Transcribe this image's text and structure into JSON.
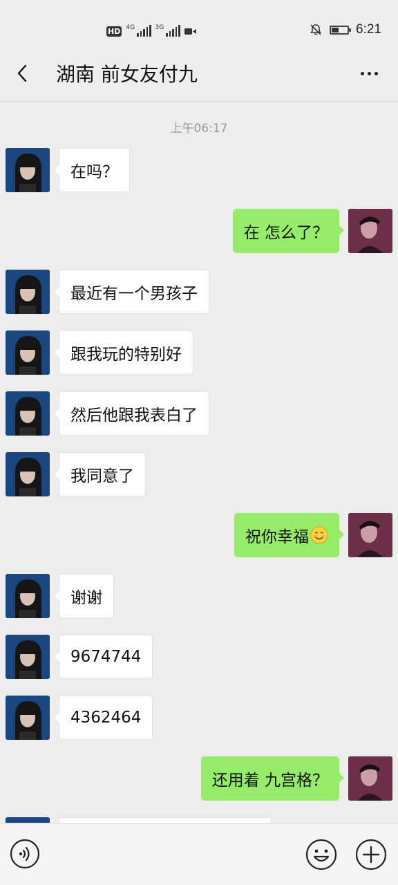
{
  "status_bar": {
    "hd": "HD",
    "net1": "4G",
    "net2": "3G",
    "time": "6:21"
  },
  "header": {
    "title": "湖南 前女友付九"
  },
  "timestamp": "上午06:17",
  "messages": [
    {
      "side": "left",
      "text": "在吗？"
    },
    {
      "side": "right",
      "text": "在 怎么了？"
    },
    {
      "side": "left",
      "text": "最近有一个男孩子"
    },
    {
      "side": "left",
      "text": "跟我玩的特别好"
    },
    {
      "side": "left",
      "text": "然后他跟我表白了"
    },
    {
      "side": "left",
      "text": "我同意了"
    },
    {
      "side": "right",
      "text": "祝你幸福",
      "emoji": "smile-emoji"
    },
    {
      "side": "left",
      "text": "谢谢"
    },
    {
      "side": "left",
      "text": "9674744"
    },
    {
      "side": "left",
      "text": "4362464"
    },
    {
      "side": "right",
      "text": "还用着 九宫格？"
    },
    {
      "side": "left",
      "text": ""
    }
  ],
  "input_bar": {
    "icons": [
      "voice-icon",
      "emoji-icon",
      "plus-icon"
    ]
  },
  "colors": {
    "background": "#ededed",
    "bubble_self": "#95ec69",
    "bubble_other": "#ffffff"
  }
}
